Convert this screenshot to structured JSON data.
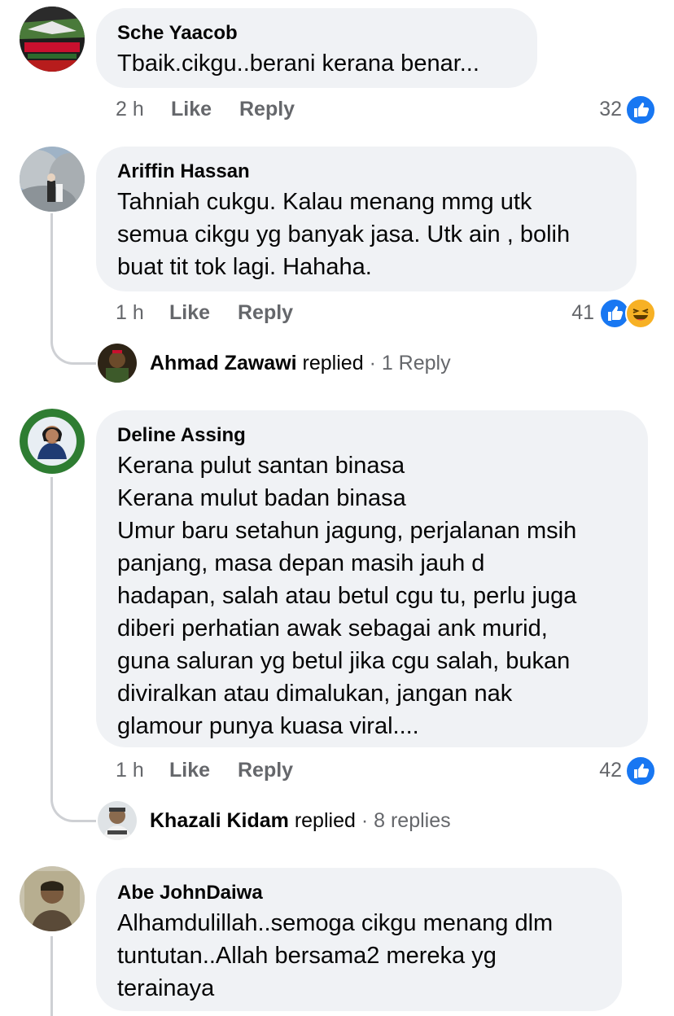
{
  "colors": {
    "bubble": "#f0f2f5",
    "meta": "#65676b",
    "like_blue": "#1877f2",
    "haha_yellow": "#f7b125",
    "thread_line": "#ced0d4"
  },
  "comments": [
    {
      "author": "Sche Yaacob",
      "text": "Tbaik.cikgu..berani kerana benar...",
      "time": "2 h",
      "like_label": "Like",
      "reply_label": "Reply",
      "reaction_count": "32",
      "reactions": [
        "like-icon"
      ],
      "avatar_icon": "free-gaza-avatar"
    },
    {
      "author": "Ariffin Hassan",
      "text": "Tahniah cukgu. Kalau menang mmg utk\nsemua cikgu yg banyak jasa. Utk ain , bolih\nbuat tit tok lagi. Hahaha.",
      "time": "1 h",
      "like_label": "Like",
      "reply_label": "Reply",
      "reaction_count": "41",
      "reactions": [
        "like-icon",
        "haha-icon"
      ],
      "avatar_icon": "rocks-photo-avatar",
      "reply_summary": {
        "name": "Ahmad Zawawi",
        "verb": "replied",
        "count": "· 1 Reply"
      }
    },
    {
      "author": "Deline Assing",
      "text": "Kerana pulut santan binasa\nKerana mulut badan binasa\nUmur baru setahun jagung, perjalanan msih\npanjang, masa depan masih jauh d\nhadapan, salah atau betul cgu tu, perlu juga\ndiberi perhatian awak sebagai ank murid,\nguna saluran yg betul jika cgu salah, bukan\ndiviralkan atau dimalukan, jangan nak\nglamour punya kuasa viral....",
      "time": "1 h",
      "like_label": "Like",
      "reply_label": "Reply",
      "reaction_count": "42",
      "reactions": [
        "like-icon"
      ],
      "avatar_icon": "vaccinated-frame-avatar",
      "reply_summary": {
        "name": "Khazali Kidam",
        "verb": "replied",
        "count": "· 8 replies"
      }
    },
    {
      "author": "Abe JohnDaiwa",
      "text": "Alhamdulillah..semoga cikgu menang dlm\ntuntutan..Allah bersama2 mereka yg\nterainaya",
      "avatar_icon": "vintage-photo-avatar"
    }
  ]
}
